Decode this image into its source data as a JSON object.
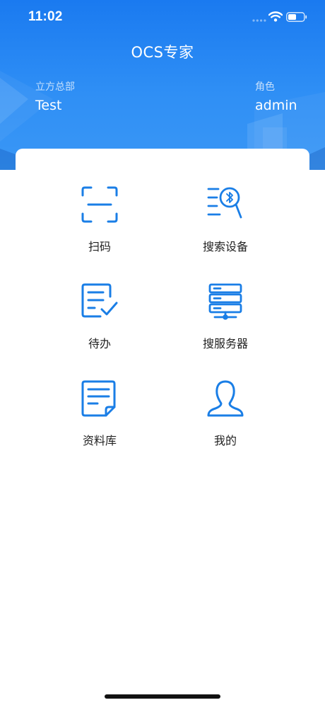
{
  "status_bar": {
    "time": "11:02",
    "icons": [
      "cellular-signal-icon",
      "wifi-icon",
      "battery-icon"
    ]
  },
  "header": {
    "title": "OCS专家",
    "org_label": "立方总部",
    "org_value": "Test",
    "role_label": "角色",
    "role_value": "admin"
  },
  "menu": {
    "items": [
      {
        "label": "扫码",
        "icon": "scan-icon"
      },
      {
        "label": "搜索设备",
        "icon": "bluetooth-search-icon"
      },
      {
        "label": "待办",
        "icon": "todo-check-icon"
      },
      {
        "label": "搜服务器",
        "icon": "server-icon"
      },
      {
        "label": "资料库",
        "icon": "document-library-icon"
      },
      {
        "label": "我的",
        "icon": "user-profile-icon"
      }
    ]
  },
  "colors": {
    "header_blue": "#1a7af0",
    "icon_blue": "#1a7ee6",
    "text_dark": "#222222"
  }
}
